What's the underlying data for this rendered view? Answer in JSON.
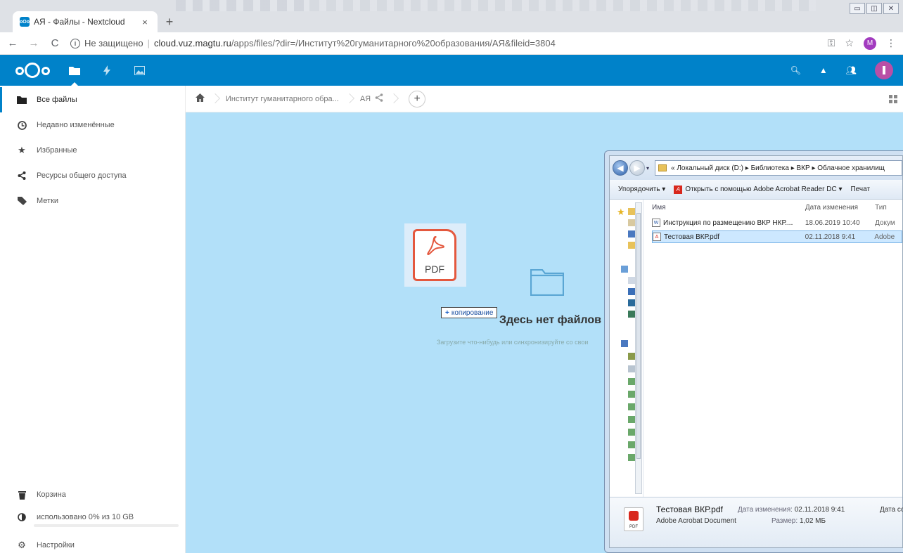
{
  "browser": {
    "tab_title": "АЯ - Файлы - Nextcloud",
    "tab_close": "×",
    "new_tab": "+",
    "security_label": "Не защищено",
    "url_host": "cloud.vuz.magtu.ru",
    "url_path": "/apps/files/?dir=/Институт%20гуманитарного%20образования/АЯ&fileid=3804",
    "profile_initial": "M"
  },
  "sidebar": {
    "items": [
      {
        "label": "Все файлы",
        "icon": "folder-icon"
      },
      {
        "label": "Недавно изменённые",
        "icon": "clock-icon"
      },
      {
        "label": "Избранные",
        "icon": "star-icon"
      },
      {
        "label": "Ресурсы общего доступа",
        "icon": "share-icon"
      },
      {
        "label": "Метки",
        "icon": "tag-icon"
      }
    ],
    "trash_label": "Корзина",
    "quota_label": "использовано 0% из 10 GB",
    "quota_fraction": 0.0,
    "settings_label": "Настройки"
  },
  "breadcrumb": {
    "items": [
      "Институт гуманитарного обра...",
      "АЯ"
    ],
    "add_label": "+"
  },
  "empty": {
    "title": "Здесь нет файлов",
    "subtitle": "Загрузите что-нибудь или синхронизируйте со свои"
  },
  "drag": {
    "file_type_label": "PDF",
    "action_label": "копирование",
    "action_prefix": "+"
  },
  "explorer": {
    "path": "« Локальный диск (D:) ▸ Библиотека ▸ ВКР ▸ Облачное хранилищ",
    "organize_label": "Упорядочить ▾",
    "open_with_label": "Открыть с помощью Adobe Acrobat Reader DC ▾",
    "print_label": "Печат",
    "columns": {
      "name": "Имя",
      "date": "Дата изменения",
      "type": "Тип"
    },
    "rows": [
      {
        "name": "Инструкция по размещению ВКР НКР....",
        "date": "18.06.2019 10:40",
        "type": "Докум",
        "icon": "word-doc-icon",
        "selected": false
      },
      {
        "name": "Тестовая ВКР.pdf",
        "date": "02.11.2018 9:41",
        "type": "Adobe",
        "icon": "pdf-file-icon",
        "selected": true
      }
    ],
    "details": {
      "file_name": "Тестовая ВКР.pdf",
      "file_type": "Adobe Acrobat Document",
      "modified_key": "Дата изменения:",
      "modified_value": "02.11.2018 9:41",
      "size_key": "Размер:",
      "size_value": "1,02 МБ",
      "created_key": "Дата со",
      "icon_label": "PDF"
    }
  },
  "colors": {
    "nextcloud_blue": "#0082c9",
    "drop_zone": "#b2e0f9",
    "pdf_red": "#e4583e"
  }
}
